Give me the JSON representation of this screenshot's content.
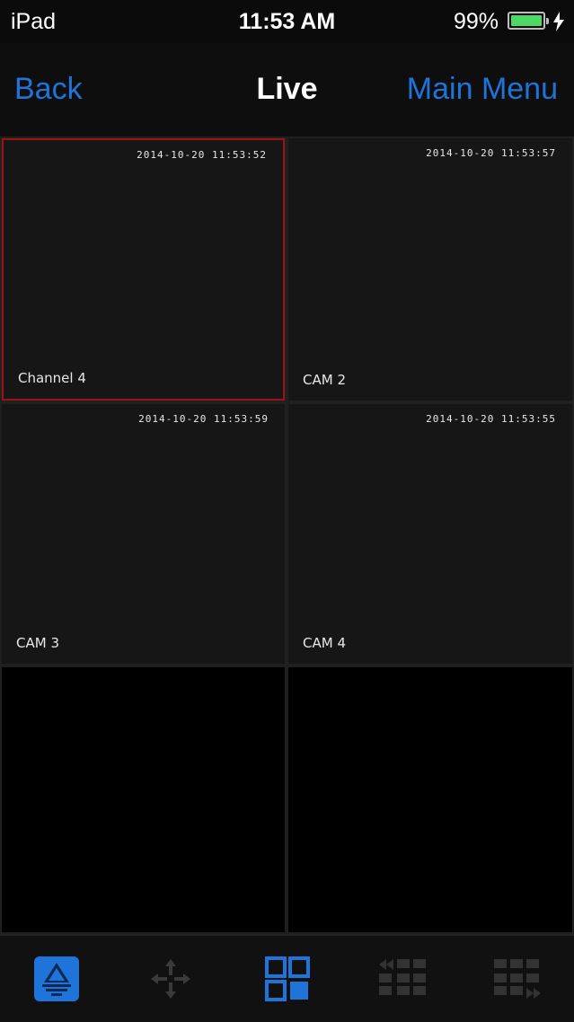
{
  "status_bar": {
    "carrier": "iPad",
    "time": "11:53 AM",
    "battery_percent_text": "99%",
    "battery_level": 0.99,
    "battery_color": "#4cd964"
  },
  "nav": {
    "back_label": "Back",
    "title": "Live",
    "main_menu_label": "Main Menu",
    "accent_color": "#1e74d8"
  },
  "tiles": [
    {
      "timestamp": "2014-10-20 11:53:52",
      "label": "Channel 4",
      "selected": true
    },
    {
      "timestamp": "2014-10-20 11:53:57",
      "label": "CAM 2",
      "selected": false
    },
    {
      "timestamp": "2014-10-20 11:53:59",
      "label": "CAM 3",
      "selected": false
    },
    {
      "timestamp": "2014-10-20 11:53:55",
      "label": "CAM 4",
      "selected": false
    },
    {
      "timestamp": "",
      "label": "",
      "selected": false
    },
    {
      "timestamp": "",
      "label": "",
      "selected": false
    }
  ],
  "toolbar": {
    "items": [
      {
        "icon": "live-view-icon",
        "active": true
      },
      {
        "icon": "ptz-move-icon",
        "active": false
      },
      {
        "icon": "grid-layout-icon",
        "active": true
      },
      {
        "icon": "previous-page-icon",
        "active": false
      },
      {
        "icon": "next-page-icon",
        "active": false
      }
    ]
  }
}
